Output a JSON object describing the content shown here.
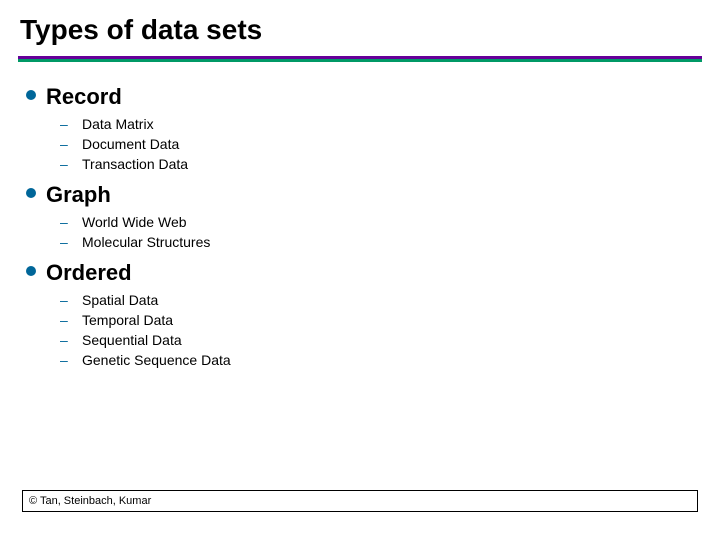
{
  "title": "Types of data sets",
  "sections": [
    {
      "heading": "Record",
      "items": [
        "Data Matrix",
        "Document Data",
        "Transaction Data"
      ]
    },
    {
      "heading": "Graph",
      "items": [
        "World Wide Web",
        "Molecular Structures"
      ]
    },
    {
      "heading": "Ordered",
      "items": [
        "Spatial Data",
        "Temporal Data",
        "Sequential Data",
        "Genetic Sequence Data"
      ]
    }
  ],
  "footer": "© Tan, Steinbach, Kumar"
}
